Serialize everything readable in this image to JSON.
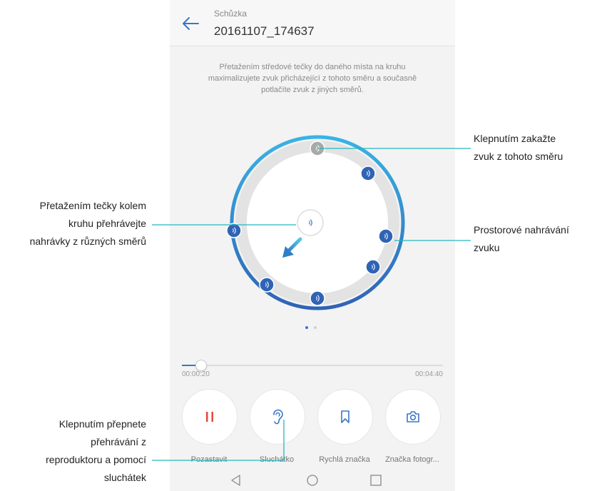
{
  "header": {
    "folder": "Schůzka",
    "filename": "20161107_174637",
    "back_icon": "arrow-left-icon"
  },
  "hint": {
    "line1": "Přetažením středové tečky do daného místa na kruhu",
    "line2": "maximalizujete zvuk přicházející z tohoto směru a současně",
    "line3": "potlačíte zvuk z jiných směrů."
  },
  "progress": {
    "current": "00:00:20",
    "total": "00:04:40",
    "fraction": 0.071
  },
  "controls": {
    "pause": "Pozastavit",
    "earpiece": "Sluchátko",
    "quick_tag": "Rychlá značka",
    "photo_tag": "Značka fotogr..."
  },
  "callouts": {
    "disable_sound": [
      "Klepnutím zakažte",
      "zvuk z tohoto směru"
    ],
    "drag_dot": [
      "Přetažením tečky kolem",
      "kruhu přehrávejte",
      "nahrávky z různých směrů"
    ],
    "spatial": [
      "Prostorové nahrávání",
      "zvuku"
    ],
    "switch_playback": [
      "Klepnutím přepnete",
      "přehrávání z",
      "reproduktoru a pomocí",
      "sluchátek"
    ]
  },
  "colors": {
    "accent": "#3a76c8",
    "dot_blue": "#2f63b5",
    "dot_gray": "#a9a9a9",
    "ring_light": "#3ab3e5",
    "ring_dark": "#2f63b5",
    "pause_red": "#e8463f",
    "callout_line": "#23b8c0"
  },
  "icons": {
    "sound_dot": "sound-wave-icon",
    "pause": "pause-icon",
    "earpiece": "ear-icon",
    "quick_tag": "bookmark-icon",
    "photo_tag": "camera-icon",
    "nav_back": "triangle-back-icon",
    "nav_home": "circle-home-icon",
    "nav_recent": "square-recent-icon"
  }
}
